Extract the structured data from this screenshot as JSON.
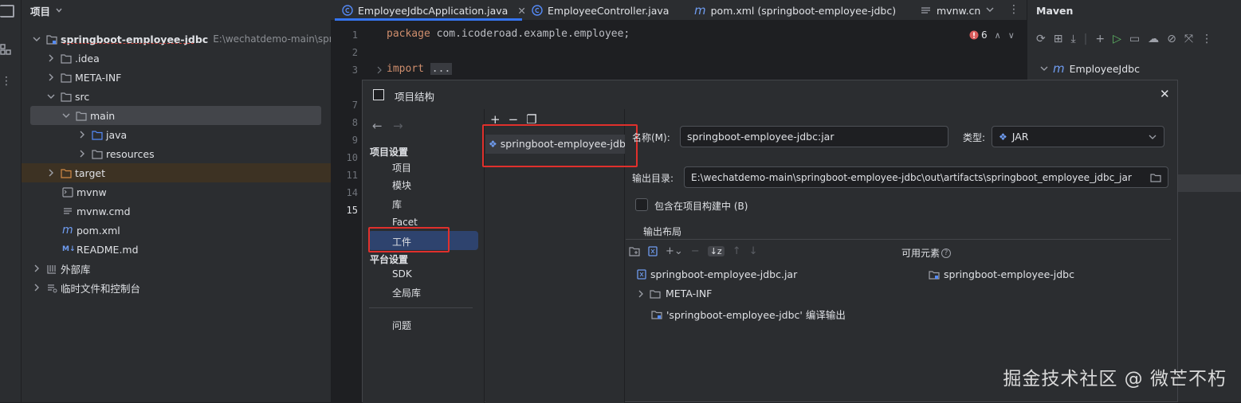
{
  "project": {
    "header": "项目",
    "root_name": "springboot-employee-jdbc",
    "root_path": "E:\\wechatdemo-main\\springb",
    "nodes": [
      ".idea",
      "META-INF",
      "src",
      "main",
      "java",
      "resources",
      "target",
      "mvnw",
      "mvnw.cmd",
      "pom.xml",
      "README.md",
      "外部库",
      "临时文件和控制台"
    ]
  },
  "tabs": [
    "EmployeeJdbcApplication.java",
    "EmployeeController.java",
    "pom.xml (springboot-employee-jdbc)",
    "mvnw.cn"
  ],
  "editor": {
    "line_numbers": [
      "1",
      "2",
      "3",
      "7",
      "8",
      "9",
      "10",
      "11",
      "14",
      "15"
    ],
    "line1_keyword": "package",
    "line1_rest": "com.icoderoad.example.employee;",
    "line3_keyword": "import",
    "line3_rest": "...",
    "problems_count": "6"
  },
  "maven": {
    "title": "Maven",
    "project": "EmployeeJdbc"
  },
  "dialog": {
    "title": "项目结构",
    "nav": {
      "section1": "项目设置",
      "items1": [
        "项目",
        "模块",
        "库",
        "Facet",
        "工件"
      ],
      "section2": "平台设置",
      "items2": [
        "SDK",
        "全局库"
      ],
      "problems": "问题"
    },
    "artifact_item": "springboot-employee-jdbc",
    "name_label": "名称(M):",
    "name_value": "springboot-employee-jdbc:jar",
    "type_label": "类型:",
    "type_value": "JAR",
    "output_dir_label": "输出目录:",
    "output_dir_value": "E:\\wechatdemo-main\\springboot-employee-jdbc\\out\\artifacts\\springboot_employee_jdbc_jar",
    "include_in_build": "包含在项目构建中 (B)",
    "output_layout_tab": "输出布局",
    "available_elements": "可用元素",
    "layout_tree": [
      "springboot-employee-jdbc.jar",
      "META-INF",
      "'springboot-employee-jdbc' 编译输出"
    ],
    "available_tree": [
      "springboot-employee-jdbc"
    ]
  },
  "watermark": "掘金技术社区 @ 微芒不朽",
  "colors": {
    "accent_selection": "#2e436e",
    "highlight_red": "#e0302c",
    "keyword": "#cf8e6d",
    "folder_blue": "#548af7"
  }
}
